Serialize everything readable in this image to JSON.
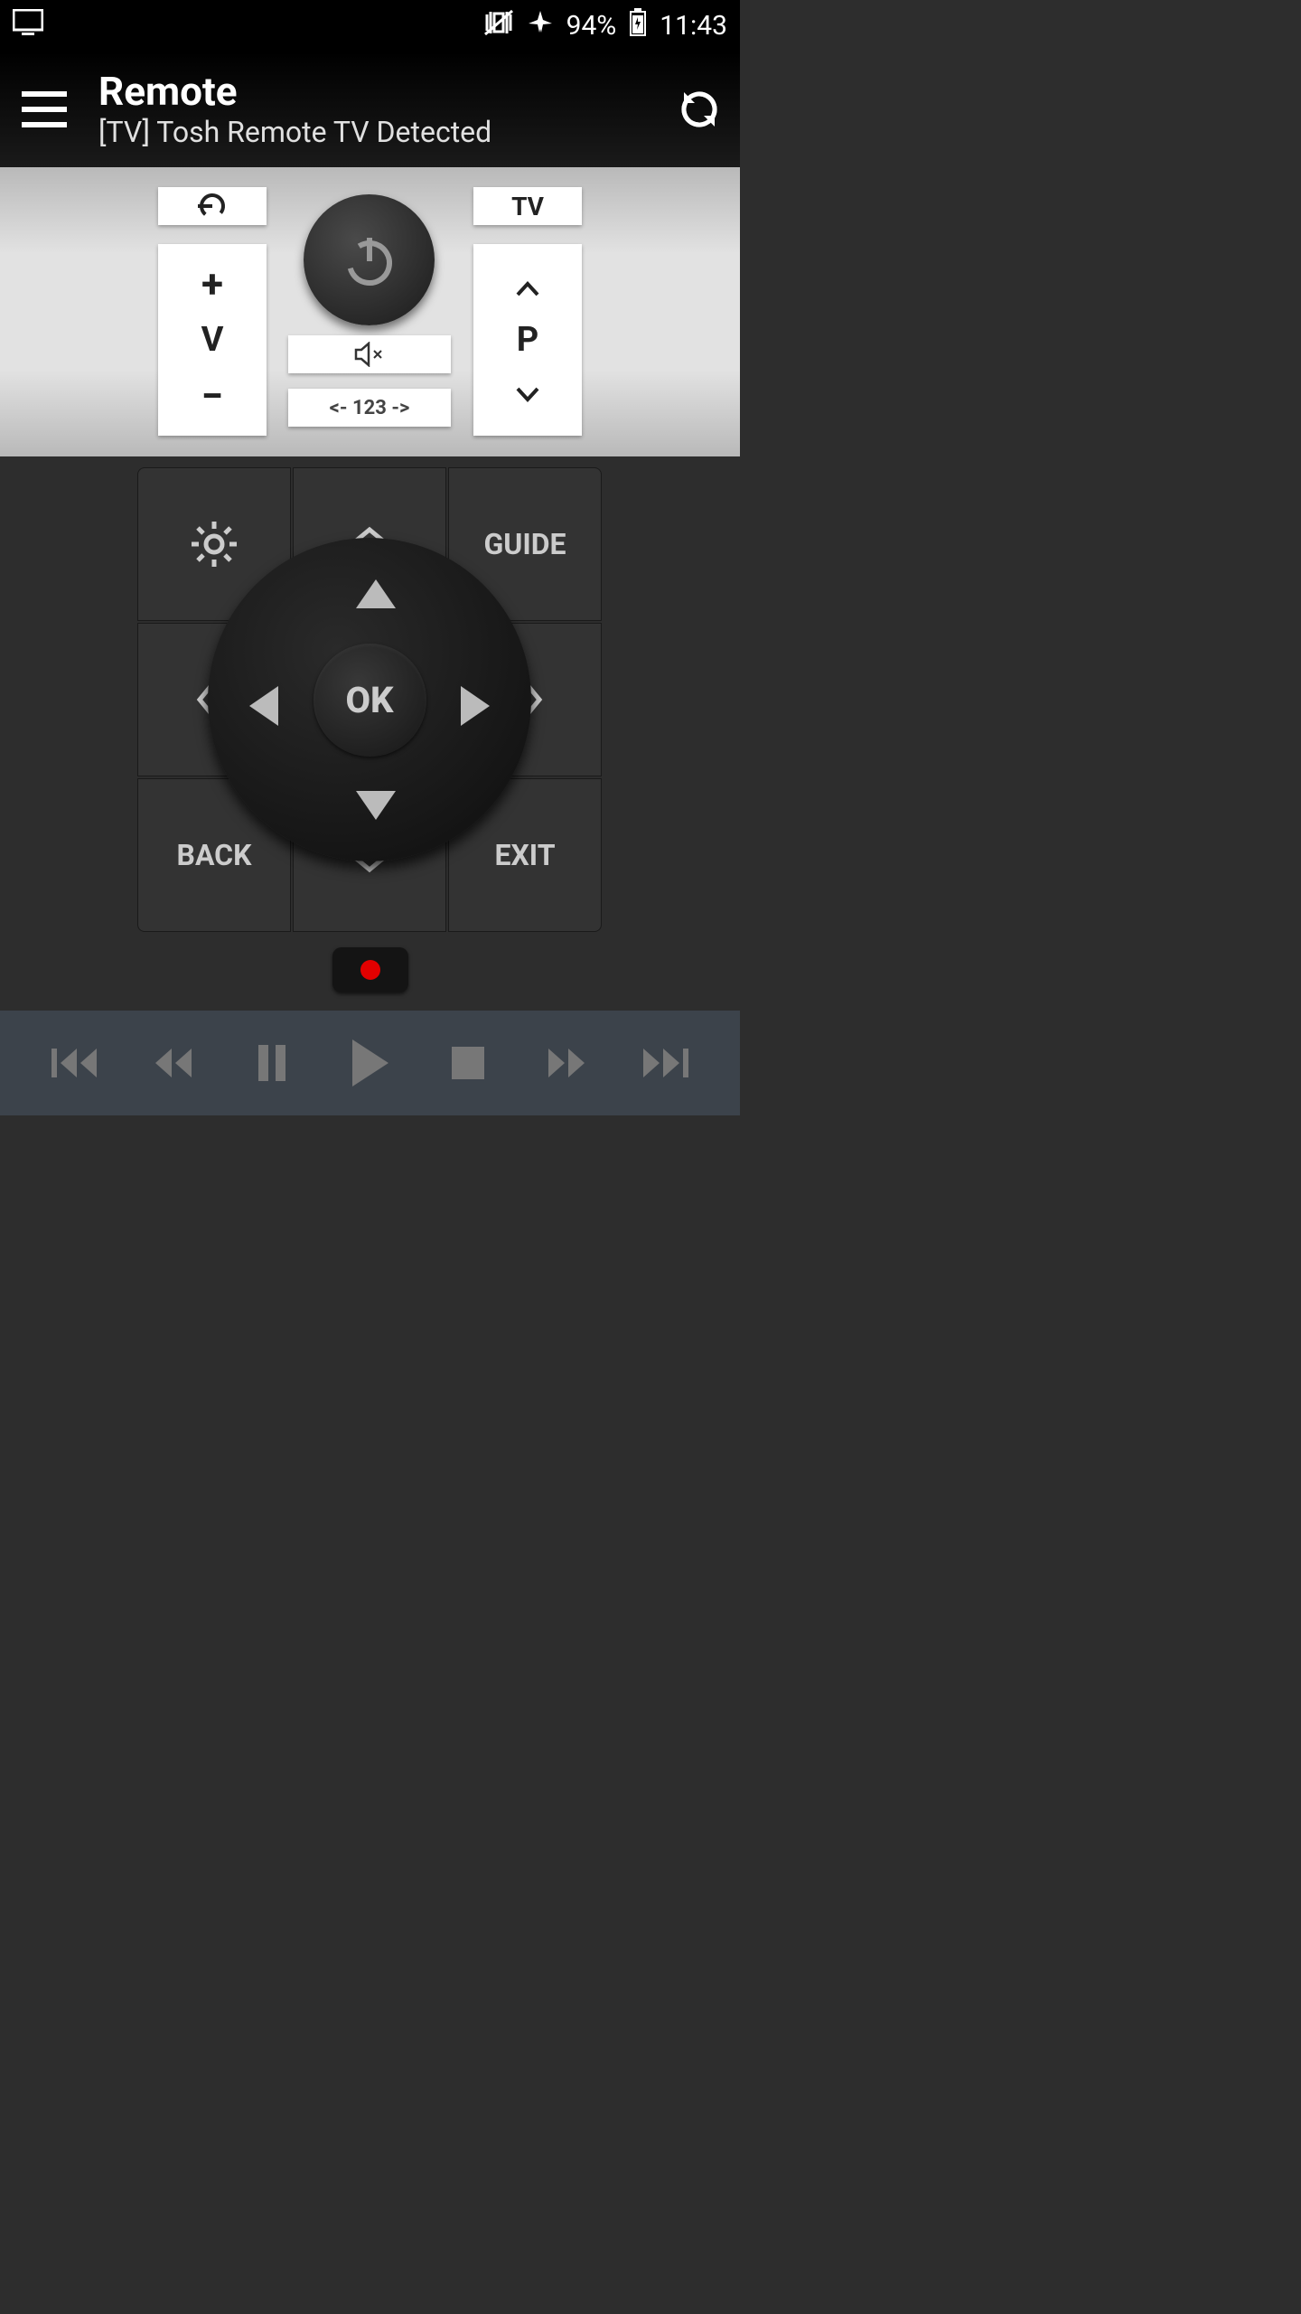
{
  "status_bar": {
    "battery_pct": "94%",
    "clock": "11:43"
  },
  "header": {
    "title": "Remote",
    "subtitle": "[TV] Tosh Remote TV Detected"
  },
  "silver": {
    "tv_label": "TV",
    "volume_label": "V",
    "program_label": "P",
    "numpad_label": "<- 123 ->"
  },
  "nav": {
    "guide": "GUIDE",
    "back": "BACK",
    "exit": "EXIT",
    "ok": "OK"
  },
  "icons": {
    "source": "⟲",
    "plus": "+",
    "minus": "−"
  }
}
